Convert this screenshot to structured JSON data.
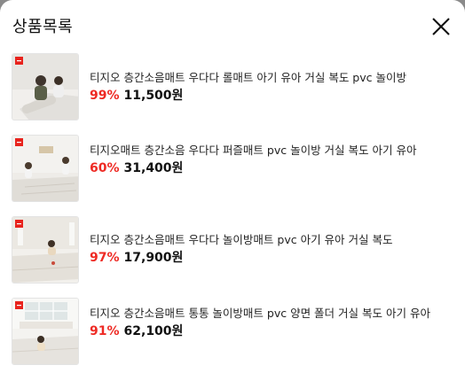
{
  "header": {
    "title": "상품목록",
    "close_icon": "close-icon"
  },
  "products": [
    {
      "name": "티지오 층간소음매트 우다다 롤매트 아기 유아 거실 복도 pvc 놀이방",
      "discount": "99%",
      "price": "11,500원"
    },
    {
      "name": "티지오매트 층간소음 우다다 퍼즐매트 pvc 놀이방 거실 복도 아기 유아",
      "discount": "60%",
      "price": "31,400원"
    },
    {
      "name": "티지오 층간소음매트 우다다 놀이방매트 pvc 아기 유아 거실 복도",
      "discount": "97%",
      "price": "17,900원"
    },
    {
      "name": "티지오 층간소음매트 통통 놀이방매트 pvc 양면 폴더 거실 복도 아기 유아",
      "discount": "91%",
      "price": "62,100원"
    }
  ],
  "colors": {
    "discount": "#ee2a24",
    "brand_badge": "#e8231d"
  }
}
